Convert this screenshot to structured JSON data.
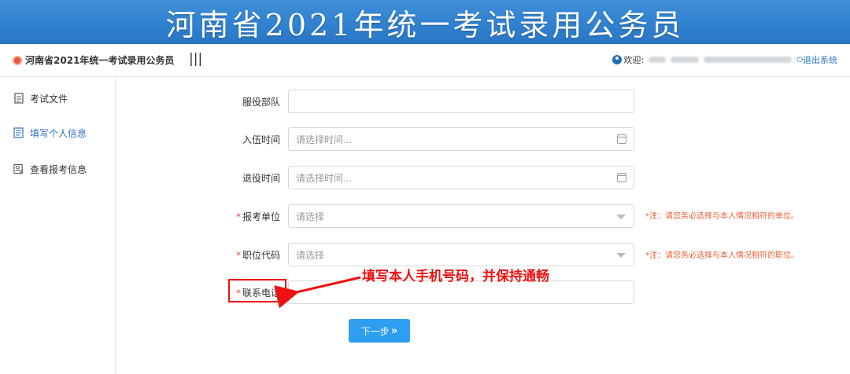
{
  "banner": {
    "title": "河南省2021年统一考试录用公务员"
  },
  "topbar": {
    "app_name": "河南省2021年统一考试录用公务员",
    "menu_toggle": "|||",
    "welcome": "欢迎:",
    "logout": "退出系统"
  },
  "sidebar": {
    "items": [
      {
        "label": "考试文件",
        "icon": "document-icon",
        "active": false
      },
      {
        "label": "填写个人信息",
        "icon": "form-icon",
        "active": true
      },
      {
        "label": "查看报考信息",
        "icon": "profile-search-icon",
        "active": false
      }
    ]
  },
  "form": {
    "fields": [
      {
        "label": "服役部队",
        "required": false,
        "type": "text",
        "placeholder": ""
      },
      {
        "label": "入伍时间",
        "required": false,
        "type": "date",
        "placeholder": "请选择时间..."
      },
      {
        "label": "退役时间",
        "required": false,
        "type": "date",
        "placeholder": "请选择时间..."
      },
      {
        "label": "报考单位",
        "required": true,
        "type": "select",
        "placeholder": "请选择",
        "note": "*注：请您务必选择与本人情况相符的单位。"
      },
      {
        "label": "职位代码",
        "required": true,
        "type": "select",
        "placeholder": "请选择",
        "note": "*注：请您务必选择与本人情况相符的职位。"
      },
      {
        "label": "联系电话",
        "required": true,
        "type": "text",
        "placeholder": ""
      }
    ],
    "required_mark": "*",
    "next_button": "下一步",
    "next_chevron": "»"
  },
  "annotation": {
    "text": "填写本人手机号码，并保持通畅",
    "color": "#ee1111"
  },
  "colors": {
    "banner": "#2f80cf",
    "accent": "#2a72c0",
    "button": "#2d9ef0",
    "note": "#e8623a"
  }
}
